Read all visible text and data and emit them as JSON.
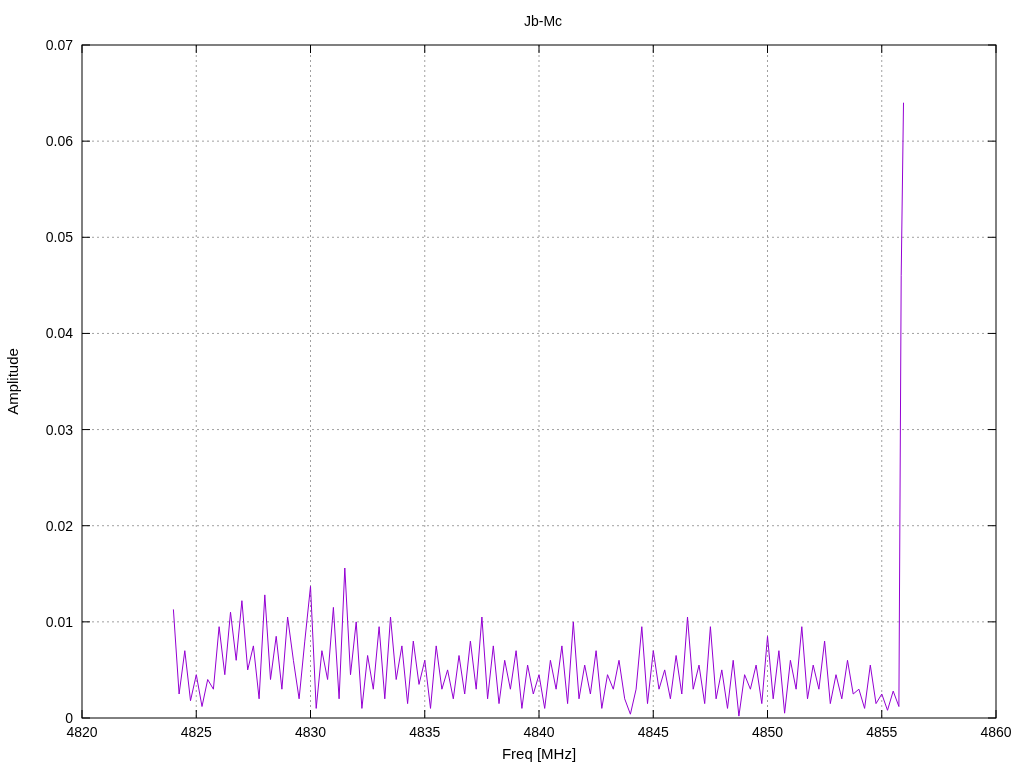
{
  "chart_data": {
    "type": "line",
    "grid": true,
    "title": "Jb-Mc",
    "xlabel": "Freq [MHz]",
    "ylabel": "Amplitude",
    "xlim": [
      4820,
      4860
    ],
    "ylim": [
      0,
      0.07
    ],
    "xticks": [
      4820,
      4825,
      4830,
      4835,
      4840,
      4845,
      4850,
      4855,
      4860
    ],
    "yticks": [
      0,
      0.01,
      0.02,
      0.03,
      0.04,
      0.05,
      0.06,
      0.07
    ],
    "x": [
      4824,
      4824.25,
      4824.5,
      4824.75,
      4825,
      4825.25,
      4825.5,
      4825.75,
      4826,
      4826.25,
      4826.5,
      4826.75,
      4827,
      4827.25,
      4827.5,
      4827.75,
      4828,
      4828.25,
      4828.5,
      4828.75,
      4829,
      4829.25,
      4829.5,
      4829.75,
      4830,
      4830.25,
      4830.5,
      4830.75,
      4831,
      4831.25,
      4831.5,
      4831.75,
      4832,
      4832.25,
      4832.5,
      4832.75,
      4833,
      4833.25,
      4833.5,
      4833.75,
      4834,
      4834.25,
      4834.5,
      4834.75,
      4835,
      4835.25,
      4835.5,
      4835.75,
      4836,
      4836.25,
      4836.5,
      4836.75,
      4837,
      4837.25,
      4837.5,
      4837.75,
      4838,
      4838.25,
      4838.5,
      4838.75,
      4839,
      4839.25,
      4839.5,
      4839.75,
      4840,
      4840.25,
      4840.5,
      4840.75,
      4841,
      4841.25,
      4841.5,
      4841.75,
      4842,
      4842.25,
      4842.5,
      4842.75,
      4843,
      4843.25,
      4843.5,
      4843.75,
      4844,
      4844.25,
      4844.5,
      4844.75,
      4845,
      4845.25,
      4845.5,
      4845.75,
      4846,
      4846.25,
      4846.5,
      4846.75,
      4847,
      4847.25,
      4847.5,
      4847.75,
      4848,
      4848.25,
      4848.5,
      4848.75,
      4849,
      4849.25,
      4849.5,
      4849.75,
      4850,
      4850.25,
      4850.5,
      4850.75,
      4851,
      4851.25,
      4851.5,
      4851.75,
      4852,
      4852.25,
      4852.5,
      4852.75,
      4853,
      4853.25,
      4853.5,
      4853.75,
      4854,
      4854.25,
      4854.5,
      4854.75,
      4855,
      4855.25,
      4855.5,
      4855.75,
      4855.85,
      4855.95
    ],
    "series": [
      {
        "color": "#9400d3",
        "values": [
          0.0113,
          0.0025,
          0.007,
          0.0018,
          0.0045,
          0.0012,
          0.004,
          0.003,
          0.0095,
          0.0045,
          0.011,
          0.006,
          0.0122,
          0.005,
          0.0075,
          0.002,
          0.0128,
          0.004,
          0.0085,
          0.003,
          0.0105,
          0.006,
          0.002,
          0.008,
          0.0137,
          0.001,
          0.007,
          0.004,
          0.0115,
          0.002,
          0.0156,
          0.0045,
          0.01,
          0.001,
          0.0065,
          0.003,
          0.0095,
          0.002,
          0.0105,
          0.004,
          0.0075,
          0.0015,
          0.008,
          0.0035,
          0.006,
          0.001,
          0.0075,
          0.003,
          0.005,
          0.002,
          0.0065,
          0.0025,
          0.008,
          0.003,
          0.0105,
          0.002,
          0.0075,
          0.0015,
          0.006,
          0.003,
          0.007,
          0.001,
          0.0055,
          0.0025,
          0.0045,
          0.001,
          0.006,
          0.003,
          0.0075,
          0.0015,
          0.01,
          0.002,
          0.0055,
          0.0025,
          0.007,
          0.001,
          0.0045,
          0.003,
          0.006,
          0.002,
          0.0004,
          0.003,
          0.0095,
          0.0015,
          0.007,
          0.003,
          0.005,
          0.002,
          0.0065,
          0.0025,
          0.0105,
          0.003,
          0.0055,
          0.0015,
          0.0095,
          0.002,
          0.005,
          0.001,
          0.006,
          0.0002,
          0.0045,
          0.003,
          0.0055,
          0.0015,
          0.0085,
          0.002,
          0.007,
          0.0005,
          0.006,
          0.003,
          0.0095,
          0.002,
          0.0055,
          0.003,
          0.008,
          0.0015,
          0.0045,
          0.002,
          0.006,
          0.0025,
          0.003,
          0.001,
          0.0055,
          0.0015,
          0.0025,
          0.0008,
          0.0028,
          0.0012,
          0.046,
          0.064
        ]
      }
    ]
  }
}
